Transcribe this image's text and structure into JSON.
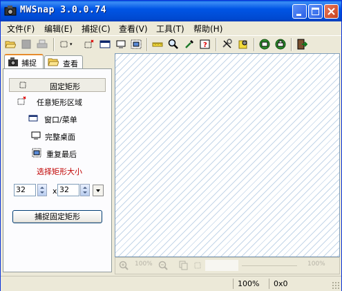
{
  "window": {
    "title": "MWSnap  3.0.0.74"
  },
  "menu": [
    "文件(F)",
    "编辑(E)",
    "捕捉(C)",
    "查看(V)",
    "工具(T)",
    "帮助(H)"
  ],
  "tabs": {
    "capture": "捕捉",
    "view": "查看"
  },
  "modes": [
    "固定矩形",
    "任意矩形区域",
    "窗口/菜单",
    "完整桌面",
    "重复最后"
  ],
  "size_label": "选择矩形大小",
  "size": {
    "width": "32",
    "times": "x",
    "height": "32"
  },
  "capture_button": "捕捉固定矩形",
  "zoombar": {
    "zoom_in": "100%",
    "zoom_out": "100%",
    "right": "100%"
  },
  "status": {
    "zoom": "100%",
    "color": "0x0"
  },
  "colors": {
    "titlebar": "#0054e3",
    "size_label": "#c00000",
    "tab_highlight": "#e68b2c"
  }
}
